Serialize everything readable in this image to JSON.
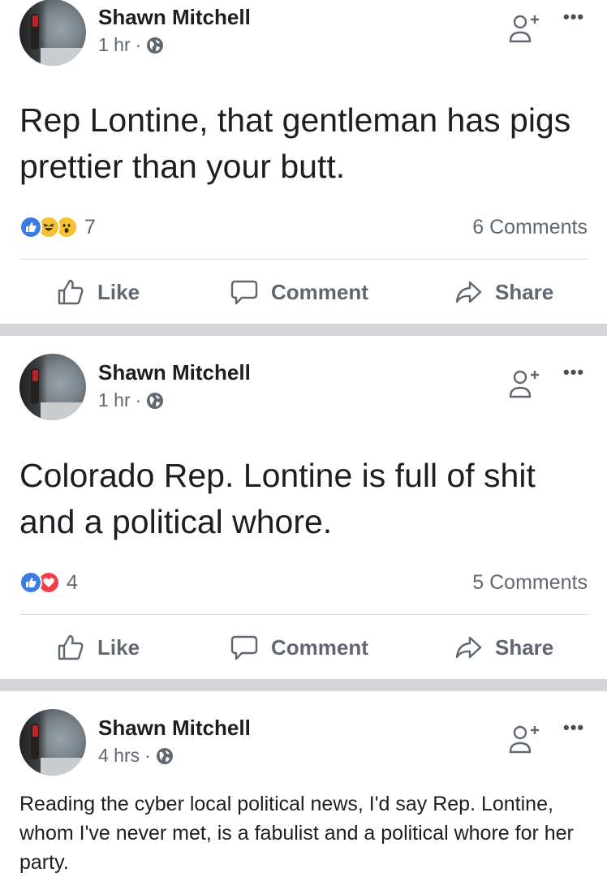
{
  "posts": [
    {
      "author": "Shawn Mitchell",
      "time": "1 hr",
      "dot": "·",
      "text": "Rep Lontine, that gentleman has pigs prettier than  your butt.",
      "reaction_count": "7",
      "comments": "6 Comments",
      "actions": {
        "like": "Like",
        "comment": "Comment",
        "share": "Share"
      }
    },
    {
      "author": "Shawn Mitchell",
      "time": "1 hr",
      "dot": "·",
      "text": "Colorado Rep. Lontine is full of shit and a political whore.",
      "reaction_count": "4",
      "comments": "5 Comments",
      "actions": {
        "like": "Like",
        "comment": "Comment",
        "share": "Share"
      }
    },
    {
      "author": "Shawn Mitchell",
      "time": "4 hrs",
      "dot": "·",
      "text": "Reading the cyber local political news, I'd say Rep. Lontine, whom I've never met, is a fabulist and a political whore for her party."
    }
  ],
  "more_symbol": "•••",
  "colors": {
    "like_blue": "#3b7be8",
    "love_red": "#ef3e4a",
    "haha_yellow": "#f7c231",
    "separator": "#d4d5d9",
    "muted_text": "#606770"
  }
}
